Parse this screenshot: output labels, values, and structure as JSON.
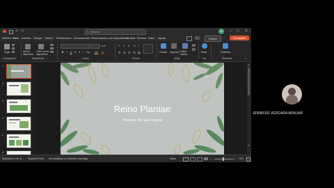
{
  "titlebar": {
    "search_placeholder": "Buscar",
    "user_initials": "JV"
  },
  "menus": [
    "Archivo",
    "Inicio",
    "Insertar",
    "Dibujar",
    "Diseño",
    "Transiciones",
    "Animaciones",
    "Presentación con diapositivas",
    "Grabar",
    "Revisar",
    "Vista",
    "Ayuda"
  ],
  "active_menu": "Inicio",
  "header_buttons": {
    "record": "Grabar",
    "share": "Compartir"
  },
  "ribbon": {
    "groups": [
      "Portapapeles",
      "Diapositivas",
      "Fuente",
      "Párrafo",
      "Dibujo",
      "Voz",
      "Diseñador"
    ],
    "buttons": {
      "paste": "Pegar",
      "new_slide": "Nueva diapositiva",
      "reuse_slides": "Volver a usar diapositivas",
      "shapes": "Formas",
      "arrange": "Organizar",
      "quick_styles": "Estilos rápidos",
      "dictate": "Dictar",
      "designer": "Diseñador"
    }
  },
  "slide": {
    "title": "Reino Plantae",
    "subtitle": "Docente: Renata Vergara",
    "current_number": "1"
  },
  "thumbnails": [
    "1",
    "2",
    "3",
    "4",
    "5",
    "6"
  ],
  "status": {
    "slide_count": "Diapositiva 1 de 11",
    "language": "Español (Perú)",
    "accessibility": "Accesibilidad: es necesario investigar",
    "notes": "Notas",
    "zoom": "74%"
  },
  "participant": {
    "name": "JENNIFER VERGARA MUNJAR"
  },
  "colors": {
    "accent": "#d2532e",
    "slide_bg": "#c0c4c0",
    "leaf_dark": "#3f7a46",
    "leaf_gold": "#b9a25a"
  }
}
